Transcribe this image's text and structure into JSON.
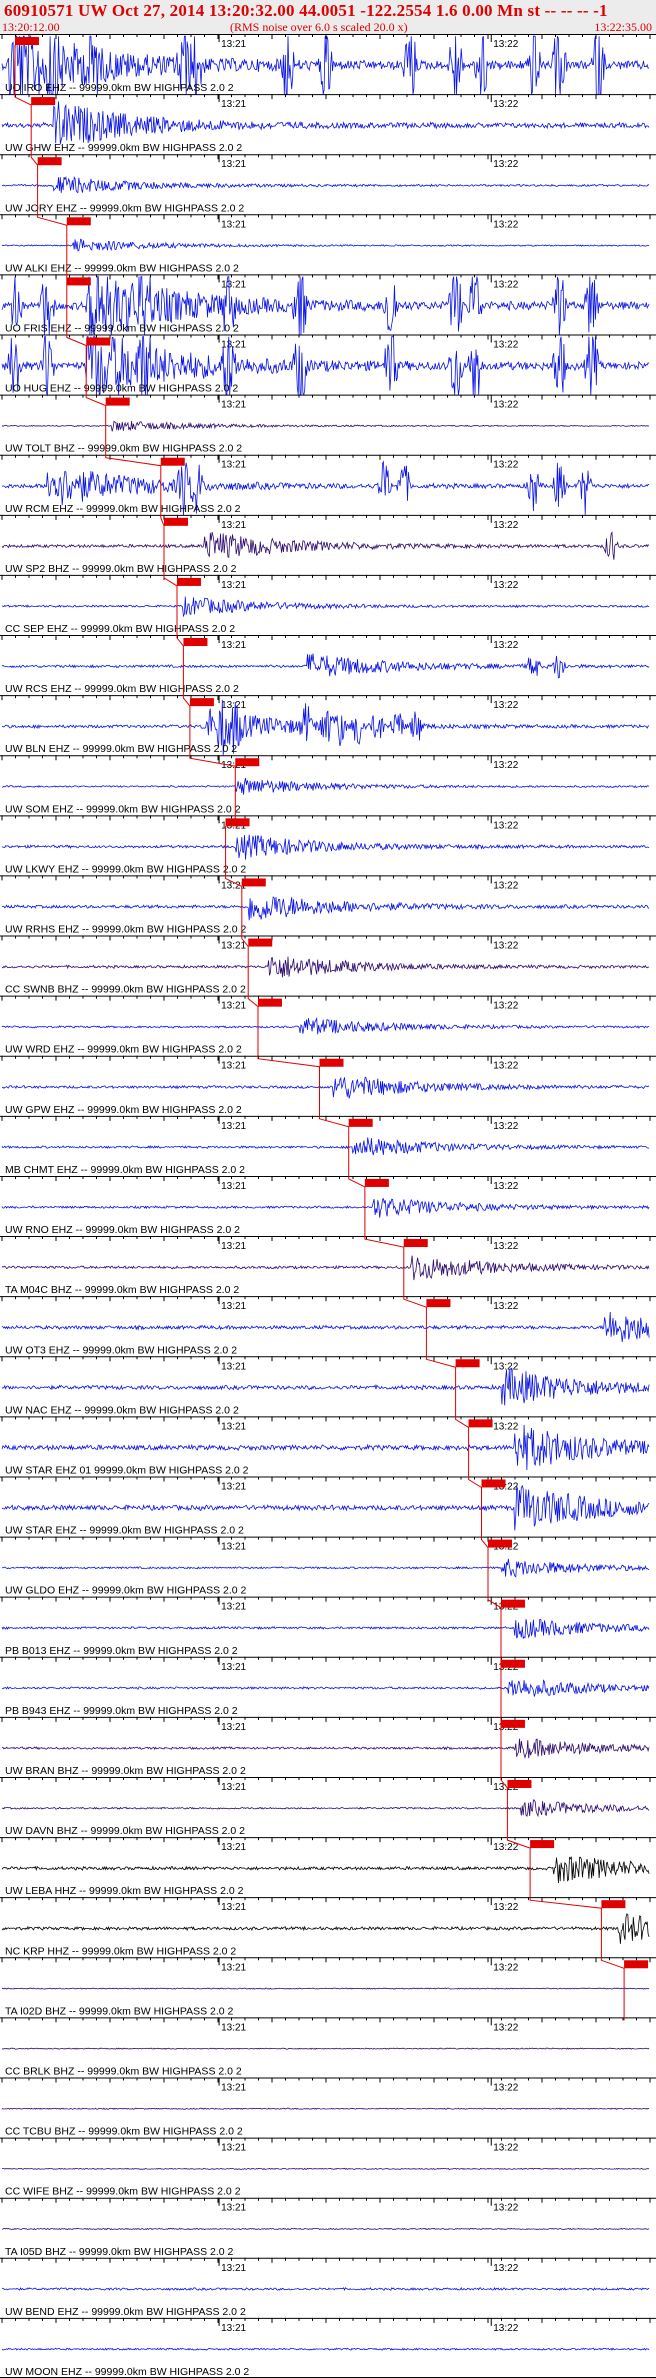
{
  "header": {
    "title": "60910571 UW Oct 27, 2014 13:20:32.00   44.0051 -122.2554  1.6 0.00 Mn st -- -- --   -1",
    "time_start": "13:20:12.00",
    "subtitle": "(RMS noise over 6.0 s scaled 20.0 x)",
    "time_end": "13:22:35.00"
  },
  "colors": {
    "accent": "#e00000",
    "blue": "#0a14e6",
    "purple": "#2e0b6e",
    "black": "#000000",
    "header_bg": "#ececec"
  },
  "chart_data": {
    "type": "line",
    "x_axis": {
      "start": "13:20:12.00",
      "end": "13:22:35.00",
      "minute_labels": [
        "13:21",
        "13:22"
      ]
    },
    "traces": [
      {
        "label": "UO IRO EHZ -- 99999.0km BW  HIGHPASS  2.0  2",
        "color": "blue",
        "amp": 1.0,
        "pick": 0.02,
        "event": 0.02,
        "bursts": [
          0.02,
          0.08,
          0.14,
          0.28,
          0.3,
          0.44,
          0.5,
          0.63,
          0.7,
          0.74,
          0.82,
          0.86,
          0.92
        ]
      },
      {
        "label": "UW GHW EHZ -- 99999.0km BW  HIGHPASS  2.0  2",
        "color": "blue",
        "amp": 0.55,
        "pick": 0.045,
        "event": 0.09,
        "bursts": []
      },
      {
        "label": "UW JORY EHZ -- 99999.0km BW  HIGHPASS  2.0  2",
        "color": "blue",
        "amp": 0.22,
        "pick": 0.055,
        "event": 0.09,
        "bursts": []
      },
      {
        "label": "UW ALKI EHZ -- 99999.0km BW  HIGHPASS  2.0  2",
        "color": "blue",
        "amp": 0.15,
        "pick": 0.1,
        "event": 0.12,
        "bursts": []
      },
      {
        "label": "UO FRIS EHZ -- 99999.0km BW  HIGHPASS  2.0  2",
        "color": "blue",
        "amp": 0.9,
        "pick": 0.1,
        "event": 0.14,
        "bursts": [
          0.02,
          0.07,
          0.14,
          0.22,
          0.35,
          0.46,
          0.6,
          0.7,
          0.73,
          0.86,
          0.91
        ]
      },
      {
        "label": "UO HUG EHZ -- 99999.0km BW  HIGHPASS  2.0  2",
        "color": "blue",
        "amp": 0.9,
        "pick": 0.13,
        "event": 0.14,
        "bursts": [
          0.02,
          0.07,
          0.14,
          0.22,
          0.35,
          0.46,
          0.6,
          0.7,
          0.73,
          0.86,
          0.91
        ]
      },
      {
        "label": "UW TOLT BHZ -- 99999.0km BW  HIGHPASS  2.0  2",
        "color": "purple",
        "amp": 0.13,
        "pick": 0.16,
        "event": 0.18,
        "bursts": []
      },
      {
        "label": "UW RCM EHZ -- 99999.0km BW  HIGHPASS  2.0  2",
        "color": "blue",
        "amp": 0.5,
        "pick": 0.245,
        "event": 0.08,
        "bursts": [
          0.28,
          0.3,
          0.59,
          0.62,
          0.82,
          0.86,
          0.9
        ]
      },
      {
        "label": "UW SP2 BHZ -- 99999.0km BW  HIGHPASS  2.0  2",
        "color": "purple",
        "amp": 0.35,
        "pick": 0.25,
        "event": 0.32,
        "bursts": [
          0.94
        ]
      },
      {
        "label": "CC SEP EHZ -- 99999.0km BW  HIGHPASS  2.0  2",
        "color": "blue",
        "amp": 0.22,
        "pick": 0.27,
        "event": 0.29,
        "bursts": []
      },
      {
        "label": "UW RCS EHZ -- 99999.0km BW  HIGHPASS  2.0  2",
        "color": "blue",
        "amp": 0.3,
        "pick": 0.28,
        "event": 0.48,
        "bursts": [
          0.82,
          0.86
        ]
      },
      {
        "label": "UW BLN EHZ -- 99999.0km BW  HIGHPASS  2.0  2",
        "color": "blue",
        "amp": 0.35,
        "pick": 0.29,
        "event": 0.34,
        "bursts": [
          0.32,
          0.34,
          0.36,
          0.47,
          0.5,
          0.52,
          0.55,
          0.58,
          0.61,
          0.64
        ]
      },
      {
        "label": "UW SOM EHZ -- 99999.0km BW  HIGHPASS  2.0  2",
        "color": "blue",
        "amp": 0.2,
        "pick": 0.36,
        "event": 0.37,
        "bursts": []
      },
      {
        "label": "UW LKWY EHZ -- 99999.0km BW  HIGHPASS  2.0  2",
        "color": "blue",
        "amp": 0.3,
        "pick": 0.345,
        "event": 0.37,
        "bursts": []
      },
      {
        "label": "UW RRHS EHZ -- 99999.0km BW  HIGHPASS  2.0  2",
        "color": "blue",
        "amp": 0.35,
        "pick": 0.37,
        "event": 0.39,
        "bursts": []
      },
      {
        "label": "CC SWNB BHZ -- 99999.0km BW  HIGHPASS  2.0  2",
        "color": "purple",
        "amp": 0.3,
        "pick": 0.38,
        "event": 0.42,
        "bursts": []
      },
      {
        "label": "UW WRD EHZ -- 99999.0km BW  HIGHPASS  2.0  2",
        "color": "blue",
        "amp": 0.22,
        "pick": 0.395,
        "event": 0.47,
        "bursts": []
      },
      {
        "label": "UW GPW EHZ -- 99999.0km BW  HIGHPASS  2.0  2",
        "color": "blue",
        "amp": 0.3,
        "pick": 0.49,
        "event": 0.52,
        "bursts": []
      },
      {
        "label": "MB CHMT EHZ -- 99999.0km BW  HIGHPASS  2.0  2",
        "color": "blue",
        "amp": 0.25,
        "pick": 0.535,
        "event": 0.55,
        "bursts": []
      },
      {
        "label": "UW RNO EHZ -- 99999.0km BW  HIGHPASS  2.0  2",
        "color": "blue",
        "amp": 0.25,
        "pick": 0.56,
        "event": 0.58,
        "bursts": []
      },
      {
        "label": "TA M04C BHZ -- 99999.0km BW  HIGHPASS  2.0  2",
        "color": "purple",
        "amp": 0.3,
        "pick": 0.62,
        "event": 0.64,
        "bursts": []
      },
      {
        "label": "UW OT3 EHZ -- 99999.0km BW  HIGHPASS  2.0  2",
        "color": "blue",
        "amp": 0.4,
        "pick": 0.655,
        "event": 0.94,
        "bursts": []
      },
      {
        "label": "UW NAC EHZ -- 99999.0km BW  HIGHPASS  2.0  2",
        "color": "blue",
        "amp": 0.45,
        "pick": 0.7,
        "event": 0.78,
        "bursts": []
      },
      {
        "label": "UW STAR EHZ 01 99999.0km BW  HIGHPASS  2.0  2",
        "color": "blue",
        "amp": 0.55,
        "pick": 0.72,
        "event": 0.8,
        "bursts": []
      },
      {
        "label": "UW STAR EHZ -- 99999.0km BW  HIGHPASS  2.0  2",
        "color": "blue",
        "amp": 0.55,
        "pick": 0.74,
        "event": 0.8,
        "bursts": []
      },
      {
        "label": "UW GLDO EHZ -- 99999.0km BW  HIGHPASS  2.0  2",
        "color": "blue",
        "amp": 0.22,
        "pick": 0.75,
        "event": 0.78,
        "bursts": []
      },
      {
        "label": "PB B013 EHZ -- 99999.0km BW  HIGHPASS  2.0  2",
        "color": "blue",
        "amp": 0.25,
        "pick": 0.77,
        "event": 0.8,
        "bursts": []
      },
      {
        "label": "PB B943 EHZ -- 99999.0km BW  HIGHPASS  2.0  2",
        "color": "blue",
        "amp": 0.25,
        "pick": 0.77,
        "event": 0.79,
        "bursts": []
      },
      {
        "label": "UW BRAN BHZ -- 99999.0km BW  HIGHPASS  2.0  2",
        "color": "purple",
        "amp": 0.25,
        "pick": 0.77,
        "event": 0.8,
        "bursts": []
      },
      {
        "label": "UW DAVN BHZ -- 99999.0km BW  HIGHPASS  2.0  2",
        "color": "purple",
        "amp": 0.2,
        "pick": 0.78,
        "event": 0.81,
        "bursts": []
      },
      {
        "label": "UW LEBA HHZ -- 99999.0km BW  HIGHPASS  2.0  2",
        "color": "black",
        "amp": 0.35,
        "pick": 0.815,
        "event": 0.86,
        "bursts": []
      },
      {
        "label": "NC KRP HHZ -- 99999.0km BW  HIGHPASS  2.0  2",
        "color": "black",
        "amp": 0.35,
        "pick": 0.925,
        "event": 0.96,
        "bursts": []
      },
      {
        "label": "TA I02D BHZ -- 99999.0km BW  HIGHPASS  2.0  2",
        "color": "purple",
        "amp": 0.12,
        "pick": 0.96,
        "event": null,
        "bursts": []
      },
      {
        "label": "CC BRLK BHZ -- 99999.0km BW  HIGHPASS  2.0  2",
        "color": "purple",
        "amp": 0.12,
        "pick": null,
        "event": null,
        "bursts": []
      },
      {
        "label": "CC TCBU BHZ -- 99999.0km BW  HIGHPASS  2.0  2",
        "color": "purple",
        "amp": 0.12,
        "pick": null,
        "event": null,
        "bursts": []
      },
      {
        "label": "CC WIFE BHZ -- 99999.0km BW  HIGHPASS  2.0  2",
        "color": "purple",
        "amp": 0.12,
        "pick": null,
        "event": null,
        "bursts": []
      },
      {
        "label": "TA I05D BHZ -- 99999.0km BW  HIGHPASS  2.0  2",
        "color": "purple",
        "amp": 0.14,
        "pick": null,
        "event": null,
        "bursts": []
      },
      {
        "label": "UW BEND EHZ -- 99999.0km BW  HIGHPASS  2.0  2",
        "color": "blue",
        "amp": 0.25,
        "pick": null,
        "event": null,
        "bursts": []
      },
      {
        "label": "UW MOON EHZ -- 99999.0km BW  HIGHPASS  2.0  2",
        "color": "blue",
        "amp": 0.2,
        "pick": null,
        "event": null,
        "bursts": []
      }
    ]
  }
}
